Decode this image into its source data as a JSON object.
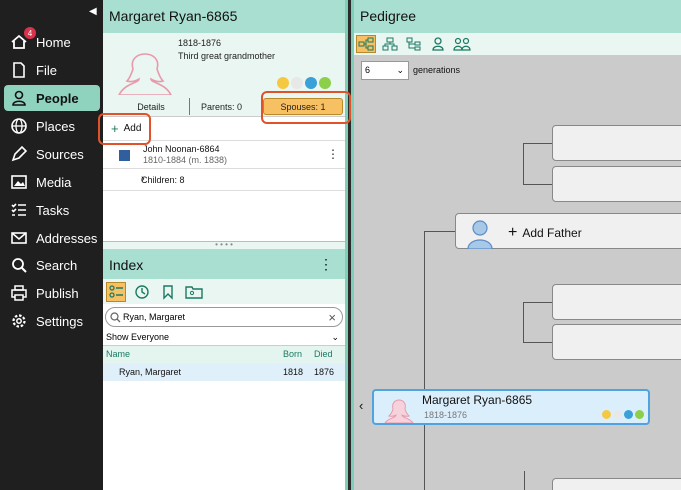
{
  "nav": {
    "items": [
      {
        "label": "Home",
        "icon": "home-icon",
        "badge": "4"
      },
      {
        "label": "File",
        "icon": "file-icon"
      },
      {
        "label": "People",
        "icon": "person-icon"
      },
      {
        "label": "Places",
        "icon": "globe-icon"
      },
      {
        "label": "Sources",
        "icon": "pen-icon"
      },
      {
        "label": "Media",
        "icon": "image-icon"
      },
      {
        "label": "Tasks",
        "icon": "checklist-icon"
      },
      {
        "label": "Addresses",
        "icon": "envelope-icon"
      },
      {
        "label": "Search",
        "icon": "search-icon"
      },
      {
        "label": "Publish",
        "icon": "printer-icon"
      },
      {
        "label": "Settings",
        "icon": "gear-icon"
      }
    ],
    "active": "People"
  },
  "person": {
    "title": "Margaret Ryan-6865",
    "years": "1818-1876",
    "relationship": "Third great grandmother",
    "tabs": {
      "details": "Details",
      "parents": "Parents: 0",
      "spouses": "Spouses: 1"
    },
    "add_label": "Add",
    "spouse": {
      "name": "John Noonan-6864",
      "dates": "1810-1884 (m. 1838)"
    },
    "children": "Children: 8",
    "flag_colors": [
      "#f5c842",
      "#e8e8e8",
      "#3aa0d8",
      "#8bcf4a"
    ]
  },
  "index": {
    "title": "Index",
    "search_value": "Ryan, Margaret",
    "filter": "Show Everyone",
    "columns": {
      "name": "Name",
      "born": "Born",
      "died": "Died"
    },
    "rows": [
      {
        "name": "Ryan, Margaret",
        "born": "1818",
        "died": "1876"
      }
    ]
  },
  "pedigree": {
    "title": "Pedigree",
    "generations_value": "6",
    "generations_label": "generations",
    "add_father": "Add Father",
    "root": {
      "name": "Margaret Ryan-6865",
      "dates": "1818-1876"
    }
  },
  "colors": {
    "accent": "#a9dfd0",
    "active_nav": "#8fd3bf",
    "highlight": "#f7c063",
    "annotation": "#e0532a"
  }
}
